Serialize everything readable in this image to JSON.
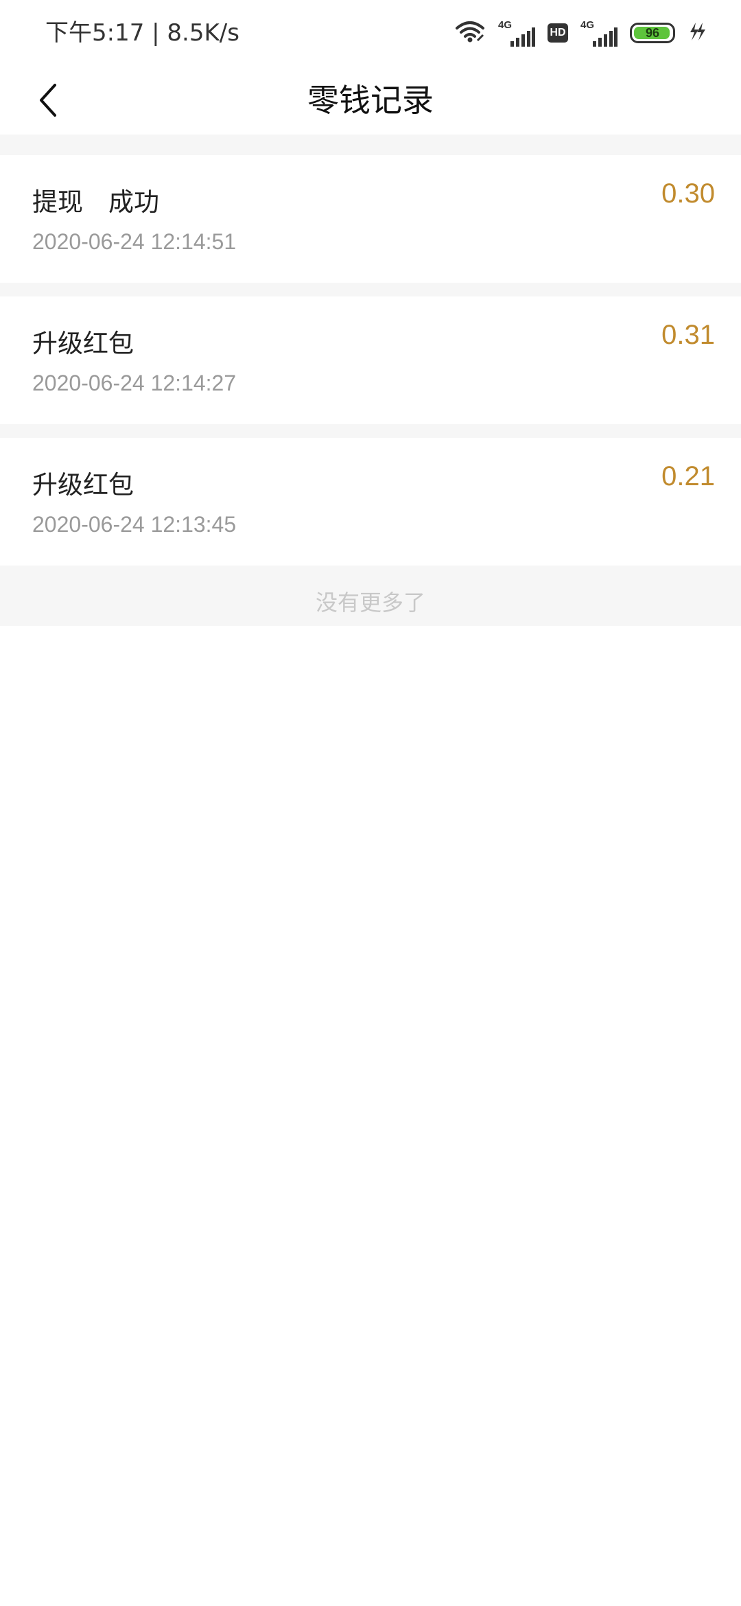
{
  "status_bar": {
    "time_text": "下午5:17 | 8.5K/s",
    "network_label_1": "4G",
    "hd_label": "HD",
    "network_label_2": "4G",
    "battery": "96",
    "battery_color": "#5ec43c"
  },
  "header": {
    "title": "零钱记录"
  },
  "records": [
    {
      "title": "提现　成功",
      "time": "2020-06-24 12:14:51",
      "amount": "0.30"
    },
    {
      "title": "升级红包",
      "time": "2020-06-24 12:14:27",
      "amount": "0.31"
    },
    {
      "title": "升级红包",
      "time": "2020-06-24 12:13:45",
      "amount": "0.21"
    }
  ],
  "footer": {
    "no_more": "没有更多了"
  },
  "colors": {
    "amount": "#c18b2e",
    "timestamp": "#9a9a9a",
    "divider_bg": "#f6f6f6"
  }
}
